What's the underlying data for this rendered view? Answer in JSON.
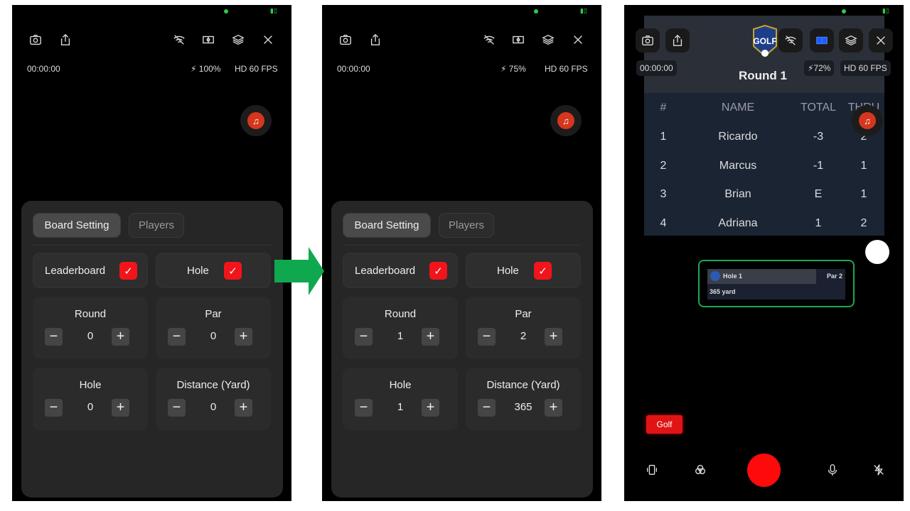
{
  "screens": [
    {
      "status": {
        "timer": "00:00:00",
        "battery": "100%",
        "quality": "HD 60 FPS"
      },
      "tabs": [
        "Board Setting",
        "Players"
      ],
      "toggles": [
        {
          "label": "Leaderboard",
          "checked": true
        },
        {
          "label": "Hole",
          "checked": true
        }
      ],
      "steppers": [
        {
          "label": "Round",
          "value": "0"
        },
        {
          "label": "Par",
          "value": "0"
        },
        {
          "label": "Hole",
          "value": "0"
        },
        {
          "label": "Distance (Yard)",
          "value": "0"
        }
      ]
    },
    {
      "status": {
        "timer": "00:00:00",
        "battery": "75%",
        "quality": "HD 60 FPS"
      },
      "tabs": [
        "Board Setting",
        "Players"
      ],
      "toggles": [
        {
          "label": "Leaderboard",
          "checked": true
        },
        {
          "label": "Hole",
          "checked": true
        }
      ],
      "steppers": [
        {
          "label": "Round",
          "value": "1"
        },
        {
          "label": "Par",
          "value": "2"
        },
        {
          "label": "Hole",
          "value": "1"
        },
        {
          "label": "Distance (Yard)",
          "value": "365"
        }
      ]
    }
  ],
  "preview": {
    "status": {
      "timer": "00:00:00",
      "battery": "72%",
      "quality": "HD 60 FPS"
    },
    "logo_text": "GOLF",
    "leaderboard": {
      "title": "Round 1",
      "columns": [
        "#",
        "NAME",
        "TOTAL",
        "THRU"
      ],
      "rows": [
        [
          "1",
          "Ricardo",
          "-3",
          "2"
        ],
        [
          "2",
          "Marcus",
          "-1",
          "1"
        ],
        [
          "3",
          "Brian",
          "E",
          "1"
        ],
        [
          "4",
          "Adriana",
          "1",
          "2"
        ]
      ]
    },
    "hole_card": {
      "hole": "Hole 1",
      "par": "Par 2",
      "distance": "365 yard"
    },
    "mode_button": "Golf"
  },
  "colors": {
    "accent_red": "#f2141b",
    "arrow_green": "#10a84e",
    "highlight_border": "#1fa74f",
    "record": "#ff0a0a"
  },
  "icons": [
    "camera-flip-icon",
    "share-icon",
    "wifi-off-icon",
    "scoreboard-icon",
    "layers-icon",
    "close-icon",
    "bolt-icon",
    "music-icon",
    "vibrate-icon",
    "filters-icon",
    "mic-icon",
    "flash-off-icon"
  ]
}
